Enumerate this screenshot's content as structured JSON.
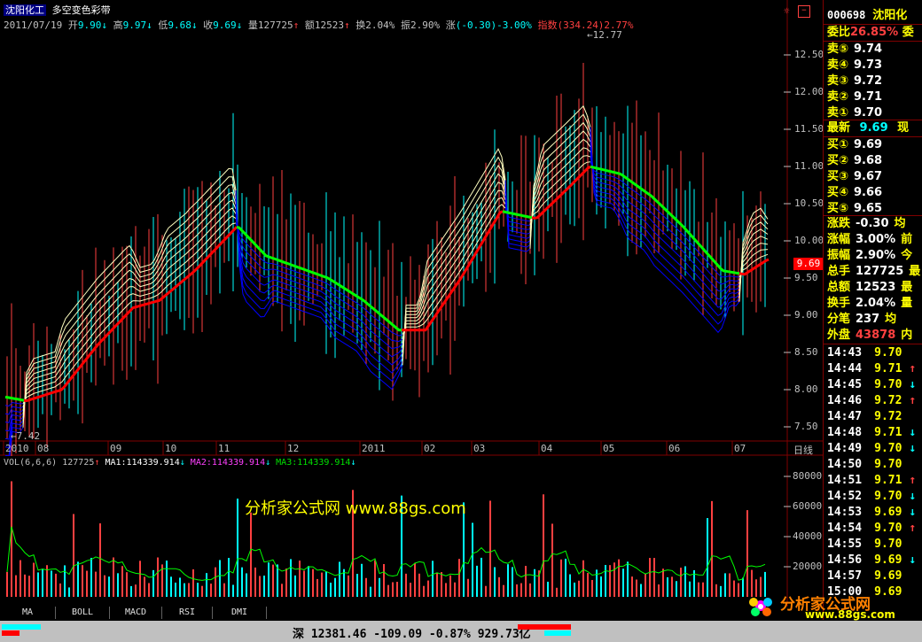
{
  "header": {
    "stock_name": "沈阳化工",
    "indicator_name": "多空变色彩带",
    "date": "2011/07/19",
    "open_label": "开",
    "open": "9.90",
    "high_label": "高",
    "high": "9.97",
    "low_label": "低",
    "low": "9.68",
    "close_label": "收",
    "close": "9.69",
    "volume_label": "量",
    "volume": "127725",
    "amount_label": "额",
    "amount": "12523",
    "turnover_label": "换",
    "turnover": "2.04%",
    "amplitude_label": "振",
    "amplitude": "2.90%",
    "change_label": "涨",
    "change": "(-0.30)-3.00%",
    "index_label": "指数",
    "index_value": "(334.24)2.77%"
  },
  "price_axis": {
    "ticks": [
      "12.50",
      "12.00",
      "11.50",
      "11.00",
      "10.50",
      "10.00",
      "9.50",
      "9.00",
      "8.50",
      "8.00",
      "7.50"
    ],
    "current_price": "9.69",
    "max_label": "12.77",
    "min_label": "7.42"
  },
  "time_axis": {
    "labels": [
      "2010",
      "08",
      "09",
      "10",
      "11",
      "12",
      "2011",
      "02",
      "03",
      "04",
      "05",
      "06",
      "07"
    ],
    "period_label": "日线"
  },
  "volume_header": {
    "title": "VOL(6,6,6)",
    "value": "127725",
    "ma1": "MA1:114339.914",
    "ma2": "MA2:114339.914",
    "ma3": "MA3:114339.914"
  },
  "volume_axis": {
    "ticks": [
      "80000",
      "60000",
      "40000",
      "20000"
    ]
  },
  "watermark": "分析家公式网 www.88gs.com",
  "right_panel": {
    "code": "000698",
    "name": "沈阳化",
    "commission_label": "委比",
    "commission_value": "26.85%",
    "commission_tail": "委",
    "asks": [
      {
        "label": "卖⑤",
        "price": "9.74"
      },
      {
        "label": "卖④",
        "price": "9.73"
      },
      {
        "label": "卖③",
        "price": "9.72"
      },
      {
        "label": "卖②",
        "price": "9.71"
      },
      {
        "label": "卖①",
        "price": "9.70"
      }
    ],
    "latest_label": "最新",
    "latest_value": "9.69",
    "latest_tail": "现",
    "bids": [
      {
        "label": "买①",
        "price": "9.69"
      },
      {
        "label": "买②",
        "price": "9.68"
      },
      {
        "label": "买③",
        "price": "9.67"
      },
      {
        "label": "买④",
        "price": "9.66"
      },
      {
        "label": "买⑤",
        "price": "9.65"
      }
    ],
    "stats": [
      {
        "label": "涨跌",
        "value": "-0.30",
        "tail": "均"
      },
      {
        "label": "涨幅",
        "value": "3.00%",
        "tail": "前"
      },
      {
        "label": "振幅",
        "value": "2.90%",
        "tail": "今"
      },
      {
        "label": "总手",
        "value": "127725",
        "tail": "最"
      },
      {
        "label": "总额",
        "value": "12523",
        "tail": "最"
      },
      {
        "label": "换手",
        "value": "2.04%",
        "tail": "量"
      },
      {
        "label": "分笔",
        "value": "237",
        "tail": "均"
      },
      {
        "label": "外盘",
        "value": "43878",
        "tail": "内"
      }
    ],
    "ticks": [
      {
        "time": "14:43",
        "price": "9.70",
        "dir": ""
      },
      {
        "time": "14:44",
        "price": "9.71",
        "dir": "↑"
      },
      {
        "time": "14:45",
        "price": "9.70",
        "dir": "↓"
      },
      {
        "time": "14:46",
        "price": "9.72",
        "dir": "↑"
      },
      {
        "time": "14:47",
        "price": "9.72",
        "dir": ""
      },
      {
        "time": "14:48",
        "price": "9.71",
        "dir": "↓"
      },
      {
        "time": "14:49",
        "price": "9.70",
        "dir": "↓"
      },
      {
        "time": "14:50",
        "price": "9.70",
        "dir": ""
      },
      {
        "time": "14:51",
        "price": "9.71",
        "dir": "↑"
      },
      {
        "time": "14:52",
        "price": "9.70",
        "dir": "↓"
      },
      {
        "time": "14:53",
        "price": "9.69",
        "dir": "↓"
      },
      {
        "time": "14:54",
        "price": "9.70",
        "dir": "↑"
      },
      {
        "time": "14:55",
        "price": "9.70",
        "dir": ""
      },
      {
        "time": "14:56",
        "price": "9.69",
        "dir": "↓"
      },
      {
        "time": "14:57",
        "price": "9.69",
        "dir": ""
      },
      {
        "time": "15:00",
        "price": "9.69",
        "dir": ""
      }
    ]
  },
  "tabs": [
    "MA",
    "BOLL",
    "MACD",
    "RSI",
    "DMI"
  ],
  "status_bar": {
    "market": "深",
    "index": "12381.46",
    "change": "-109.09",
    "pct": "-0.87%",
    "amount": "929.73亿"
  },
  "logo_text": "分析家公式网",
  "logo_url": "www.88gs.com",
  "colors": {
    "up": "#ff4040",
    "down": "#00ffff",
    "ribbon_up": "#ffffc0",
    "ribbon_down": "#0000ff",
    "line_green": "#00ff00",
    "line_red": "#ff0000"
  }
}
